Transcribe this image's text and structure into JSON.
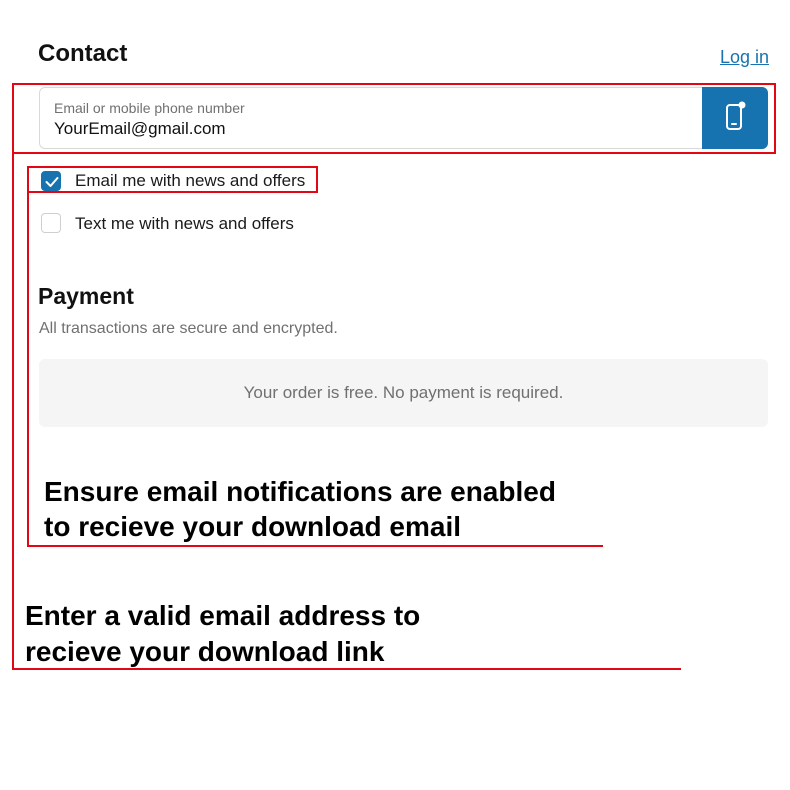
{
  "contact": {
    "title": "Contact",
    "login_link": "Log in",
    "email_field": {
      "label": "Email or mobile phone number",
      "value": "YourEmail@gmail.com"
    },
    "phone_toggle_icon": "mobile-phone-icon"
  },
  "checkboxes": [
    {
      "label": "Email me with news and offers",
      "checked": true
    },
    {
      "label": "Text me with news and offers",
      "checked": false
    }
  ],
  "payment": {
    "title": "Payment",
    "subtitle": "All transactions are secure and encrypted.",
    "notice": "Your order is free. No payment is required."
  },
  "annotations": {
    "email_notifications": [
      "Ensure email notifications are enabled",
      "to recieve your download email"
    ],
    "valid_email": [
      "Enter a valid email address to",
      "recieve your download link"
    ]
  },
  "colors": {
    "accent": "#1773b0",
    "annotation_red": "#e30613",
    "muted_text": "#707070",
    "panel_bg": "#f5f5f5"
  }
}
